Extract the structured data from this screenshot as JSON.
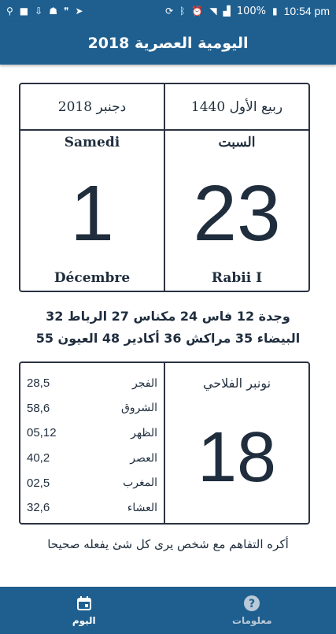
{
  "status_bar": {
    "left_icons": [
      "usb-icon",
      "video-icon",
      "download-icon",
      "android-icon",
      "quote-icon",
      "send-icon"
    ],
    "right_icons": [
      "sync-icon",
      "bluetooth-icon",
      "alarm-icon",
      "wifi-icon",
      "signal-icon",
      "battery-icon"
    ],
    "battery": "100%",
    "time": "10:54 pm"
  },
  "appbar": {
    "title": "اليومية العصرية 2018"
  },
  "date_card": {
    "gregorian_header": "دجنبر 2018",
    "hijri_header": "ربيع الأول 1440",
    "gregorian_day_name": "Samedi",
    "hijri_day_name": "السبت",
    "gregorian_day": "1",
    "hijri_day": "23",
    "gregorian_month": "Décembre",
    "hijri_month": "Rabii I"
  },
  "cities": {
    "line1": "وجدة 12 فاس 24 مكناس 27 الرباط 32",
    "line2": "البيضاء 35 مراكش 36 أكادير 48 العيون 55"
  },
  "prayer_card": {
    "prayers": [
      {
        "name": "الفجر",
        "time": "28,5"
      },
      {
        "name": "الشروق",
        "time": "58,6"
      },
      {
        "name": "الظهر",
        "time": "05,12"
      },
      {
        "name": "العصر",
        "time": "40,2"
      },
      {
        "name": "المغرب",
        "time": "02,5"
      },
      {
        "name": "العشاء",
        "time": "32,6"
      }
    ],
    "agricultural_month": "نونبر الفلاحي",
    "agricultural_day": "18"
  },
  "quote": "أكره التفاهم مع شخص يرى كل شئ يفعله صحيحا",
  "bottom_nav": {
    "today_label": "اليوم",
    "info_label": "معلومات"
  },
  "colors": {
    "primary": "#1f5f8f",
    "text": "#1f2d3d",
    "border": "#2b3344"
  }
}
